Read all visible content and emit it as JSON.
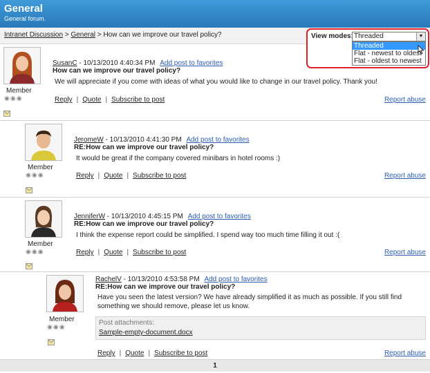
{
  "header": {
    "title": "General",
    "subtitle": "General forum."
  },
  "breadcrumb": {
    "root": "Intranet Discussion",
    "sep1": " > ",
    "forum": "General",
    "sep2": " > ",
    "current": "How can we improve our travel policy?"
  },
  "view_modes": {
    "label": "View modes:",
    "selected": "Threaded",
    "options": [
      "Threaded",
      "Flat - newest to oldest",
      "Flat - oldest to newest"
    ]
  },
  "common": {
    "member": "Member",
    "add_fav": "Add post to favorites",
    "reply": "Reply",
    "quote": "Quote",
    "subscribe": "Subscribe to post",
    "report": "Report abuse",
    "sep": "|"
  },
  "posts": [
    {
      "author": "SusanC",
      "date": " - 10/13/2010 4:40:34 PM",
      "subject": "How can we improve our travel policy?",
      "text": "We will appreciate if you come with ideas of what you would like to change in our travel policy. Thank you!"
    },
    {
      "author": "JeromeW",
      "date": " - 10/13/2010 4:41:30 PM",
      "subject": "RE:How can we improve our travel policy?",
      "text": "It would be great if the company covered minibars in hotel rooms :)"
    },
    {
      "author": "JenniferW",
      "date": " - 10/13/2010 4:45:15 PM",
      "subject": "RE:How can we improve our travel policy?",
      "text": "I think the expense report could be simplified. I spend way too much time filling it out :("
    },
    {
      "author": "RachelV",
      "date": " - 10/13/2010 4:53:58 PM",
      "subject": "RE:How can we improve our travel policy?",
      "text": "Have you seen the latest version? We have already simplified it as much as possible. If you still find something we should remove, please let us know.",
      "attachment_label": "Post attachments:",
      "attachment_file": "Sample-empty-document.docx"
    }
  ],
  "pager": {
    "page": "1"
  },
  "colors": {
    "header": "#2a79b8",
    "highlight": "#e0202a",
    "link": "#2a5db0"
  }
}
